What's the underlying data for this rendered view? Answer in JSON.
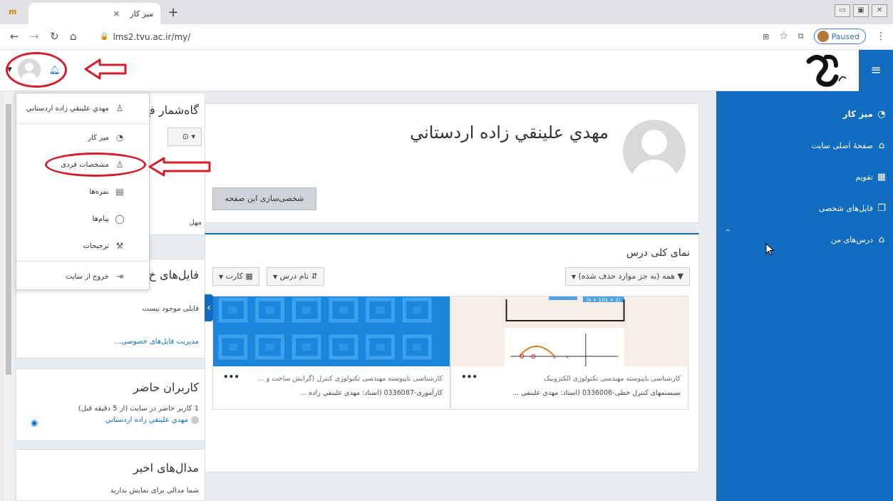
{
  "browser": {
    "tab_title": "میز کار",
    "tab_close": "×",
    "new_tab": "+",
    "url": "lms2.tvu.ac.ir/my/",
    "paused_label": "Paused"
  },
  "navbar": {
    "menu_icon": "≡",
    "bell_icon": "bell-icon"
  },
  "drawer": {
    "items": [
      {
        "label": "میز کار",
        "icon": "dashboard-icon"
      },
      {
        "label": "صفحهٔ اصلی سایت",
        "icon": "home-icon"
      },
      {
        "label": "تقویم",
        "icon": "calendar-icon"
      },
      {
        "label": "فایل‌های شخصی",
        "icon": "file-icon"
      },
      {
        "label": "درس‌های من",
        "icon": "graduation-cap-icon"
      }
    ]
  },
  "user_menu": {
    "items": [
      {
        "label": "مهدي علينقي زاده اردستاني",
        "icon": "user-icon"
      },
      {
        "label": "میز کار",
        "icon": "dashboard-icon"
      },
      {
        "label": "مشخصات فردی",
        "icon": "user-icon"
      },
      {
        "label": "نمره‌ها",
        "icon": "grades-icon"
      },
      {
        "label": "پیام‌ها",
        "icon": "message-icon"
      },
      {
        "label": "ترجیحات",
        "icon": "wrench-icon"
      },
      {
        "label": "خروج از سایت",
        "icon": "logout-icon"
      }
    ]
  },
  "blocks": {
    "timeline_title": "گاه‌شمار فع",
    "timeline_partial": "مهل",
    "files_title": "فایل‌های خ",
    "files_empty": "فایلی موجود نیست",
    "files_manage": "مدیریت فایل‌های خصوصی...",
    "online_title": "کاربران حاضر",
    "online_summary": "1 کاربر حاضر در سایت (از 5 دقیقه قبل)",
    "online_user": "مهدي علينقي زاده اردستاني",
    "badges_title": "مدال‌های اخیر",
    "badges_empty": "شما مدالی برای نمایش ندارید"
  },
  "main": {
    "page_title": "مهدي علينقي زاده اردستاني",
    "customise_button": "شخصی‌سازی این صفحه",
    "overview_title": "نمای کلی درس",
    "filter_all": "همه (به جز موارد حذف شده)",
    "sort_label": "نام درس",
    "view_label": "کارت",
    "cards": [
      {
        "line1": "کارشناسی ناپیوسته مهندسی تکنولوژی الکترونیک",
        "line2": "سیستمهای کنترل خطی-0336006 (استاد: مهدي علينقي ...",
        "more": "•••"
      },
      {
        "line1": "کارشناسی ناپیوسته مهندسی تکنولوژی کنترل (گرایش ساخت و ...",
        "line2": "کارآموزی-0336087 (استاد: مهدي علينقي زاده ...",
        "more": "•••"
      }
    ],
    "card1_formula": "(s + 1)(s + 2)"
  },
  "colors": {
    "brand": "#0f6cbf",
    "annotation": "#d21f2a"
  }
}
